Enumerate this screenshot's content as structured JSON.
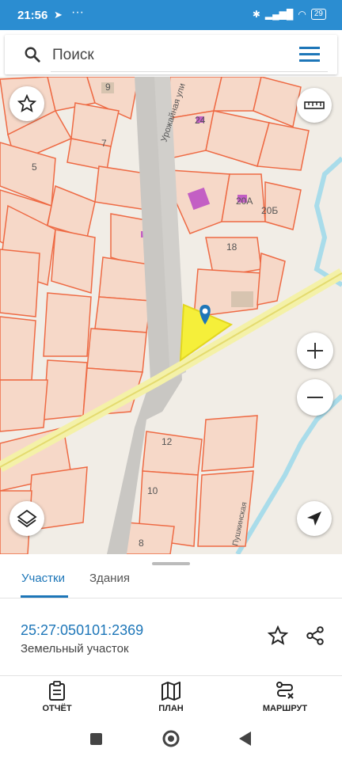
{
  "status_bar": {
    "time": "21:56",
    "battery": "29"
  },
  "search": {
    "placeholder": "Поиск"
  },
  "map": {
    "labels": [
      "9",
      "7",
      "5",
      "24",
      "20А",
      "20Б",
      "18",
      "12",
      "10",
      "8"
    ],
    "streets": [
      "Урожайная ули",
      "Пушкинская"
    ]
  },
  "tabs": [
    {
      "label": "Участки",
      "active": true
    },
    {
      "label": "Здания",
      "active": false
    }
  ],
  "parcel": {
    "id": "25:27:050101:2369",
    "type": "Земельный участок"
  },
  "bottom_nav": [
    {
      "label": "ОТЧЁТ",
      "icon": "clipboard-icon"
    },
    {
      "label": "ПЛАН",
      "icon": "map-icon"
    },
    {
      "label": "МАРШРУТ",
      "icon": "route-icon"
    }
  ],
  "colors": {
    "accent": "#1d76b8",
    "status_bar": "#2b8dd1",
    "parcel_fill": "#f6d8c8",
    "parcel_stroke": "#ee6a44",
    "selected_parcel": "#f5ef3a"
  }
}
